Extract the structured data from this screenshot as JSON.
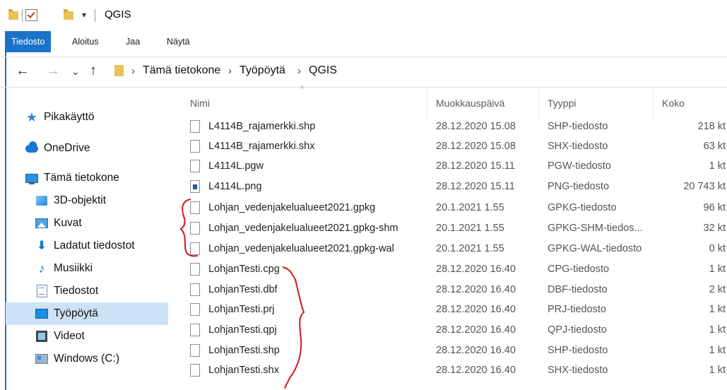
{
  "window": {
    "title": "QGIS",
    "qat_dropdown": "▾"
  },
  "ribbon": {
    "tabs": [
      "Tiedosto",
      "Aloitus",
      "Jaa",
      "Näytä"
    ]
  },
  "nav": {
    "back": "←",
    "forward": "→",
    "recent": "⌄",
    "up": "↑",
    "breadcrumb": [
      "Tämä tietokone",
      "Työpöytä",
      "QGIS"
    ],
    "sep": "›"
  },
  "sidebar": {
    "items": [
      {
        "label": "Pikakäyttö",
        "icon": "star-icon"
      },
      {
        "label": "OneDrive",
        "icon": "cloud-icon"
      },
      {
        "label": "Tämä tietokone",
        "icon": "computer-icon"
      },
      {
        "label": "3D-objektit",
        "icon": "3d-objects-icon"
      },
      {
        "label": "Kuvat",
        "icon": "pictures-icon"
      },
      {
        "label": "Ladatut tiedostot",
        "icon": "downloads-icon"
      },
      {
        "label": "Musiikki",
        "icon": "music-icon"
      },
      {
        "label": "Tiedostot",
        "icon": "documents-icon"
      },
      {
        "label": "Työpöytä",
        "icon": "desktop-icon",
        "selected": true
      },
      {
        "label": "Videot",
        "icon": "videos-icon"
      },
      {
        "label": "Windows (C:)",
        "icon": "drive-icon"
      }
    ]
  },
  "columns": {
    "name": "Nimi",
    "modified": "Muokkauspäivä",
    "type": "Tyyppi",
    "size": "Koko"
  },
  "files": [
    {
      "name": "L4114B_rajamerkki.shp",
      "modified": "28.12.2020 15.08",
      "type": "SHP-tiedosto",
      "size": "218 kt"
    },
    {
      "name": "L4114B_rajamerkki.shx",
      "modified": "28.12.2020 15.08",
      "type": "SHX-tiedosto",
      "size": "63 kt"
    },
    {
      "name": "L4114L.pgw",
      "modified": "28.12.2020 15.11",
      "type": "PGW-tiedosto",
      "size": "1 kt"
    },
    {
      "name": "L4114L.png",
      "modified": "28.12.2020 15.11",
      "type": "PNG-tiedosto",
      "size": "20 743 kt"
    },
    {
      "name": "Lohjan_vedenjakelualueet2021.gpkg",
      "modified": "20.1.2021 1.55",
      "type": "GPKG-tiedosto",
      "size": "96 kt"
    },
    {
      "name": "Lohjan_vedenjakelualueet2021.gpkg-shm",
      "modified": "20.1.2021 1.55",
      "type": "GPKG-SHM-tiedos...",
      "size": "32 kt"
    },
    {
      "name": "Lohjan_vedenjakelualueet2021.gpkg-wal",
      "modified": "20.1.2021 1.55",
      "type": "GPKG-WAL-tiedosto",
      "size": "0 kt"
    },
    {
      "name": "LohjanTesti.cpg",
      "modified": "28.12.2020 16.40",
      "type": "CPG-tiedosto",
      "size": "1 kt"
    },
    {
      "name": "LohjanTesti.dbf",
      "modified": "28.12.2020 16.40",
      "type": "DBF-tiedosto",
      "size": "2 kt"
    },
    {
      "name": "LohjanTesti.prj",
      "modified": "28.12.2020 16.40",
      "type": "PRJ-tiedosto",
      "size": "1 kt"
    },
    {
      "name": "LohjanTesti.qpj",
      "modified": "28.12.2020 16.40",
      "type": "QPJ-tiedosto",
      "size": "1 kt"
    },
    {
      "name": "LohjanTesti.shp",
      "modified": "28.12.2020 16.40",
      "type": "SHP-tiedosto",
      "size": "1 kt"
    },
    {
      "name": "LohjanTesti.shx",
      "modified": "28.12.2020 16.40",
      "type": "SHX-tiedosto",
      "size": "1 kt"
    }
  ],
  "colors": {
    "accent": "#1a73c9",
    "selection": "#cde2f7",
    "annotation": "#d11a1a"
  }
}
